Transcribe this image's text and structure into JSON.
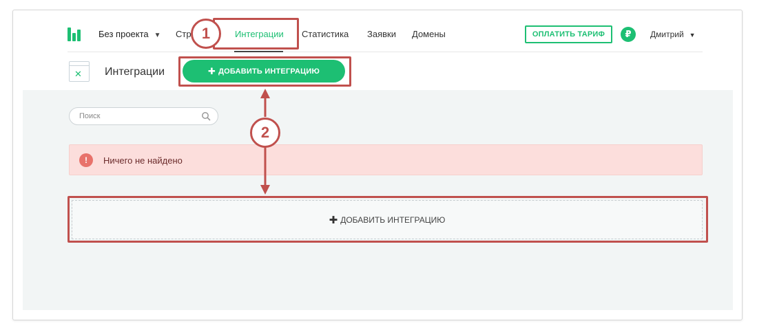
{
  "nav": {
    "project": "Без проекта",
    "links": [
      {
        "label": "Стр"
      },
      {
        "label": "Интеграции"
      },
      {
        "label": "Статистика"
      },
      {
        "label": "Заявки"
      },
      {
        "label": "Домены"
      }
    ],
    "pay_button": "ОПЛАТИТЬ ТАРИФ",
    "currency_symbol": "₽",
    "user": "Дмитрий"
  },
  "page": {
    "title": "Интеграции",
    "add_button": "ДОБАВИТЬ ИНТЕГРАЦИЮ"
  },
  "search": {
    "placeholder": "Поиск"
  },
  "alert": {
    "icon_text": "!",
    "message": "Ничего не найдено"
  },
  "add_box": {
    "label": "ДОБАВИТЬ ИНТЕГРАЦИЮ"
  },
  "annotations": {
    "step1": "1",
    "step2": "2"
  },
  "colors": {
    "accent": "#1dbf73",
    "annotation": "#c0504d",
    "alert_bg": "#fcdedc",
    "content_bg": "#f2f5f5"
  }
}
